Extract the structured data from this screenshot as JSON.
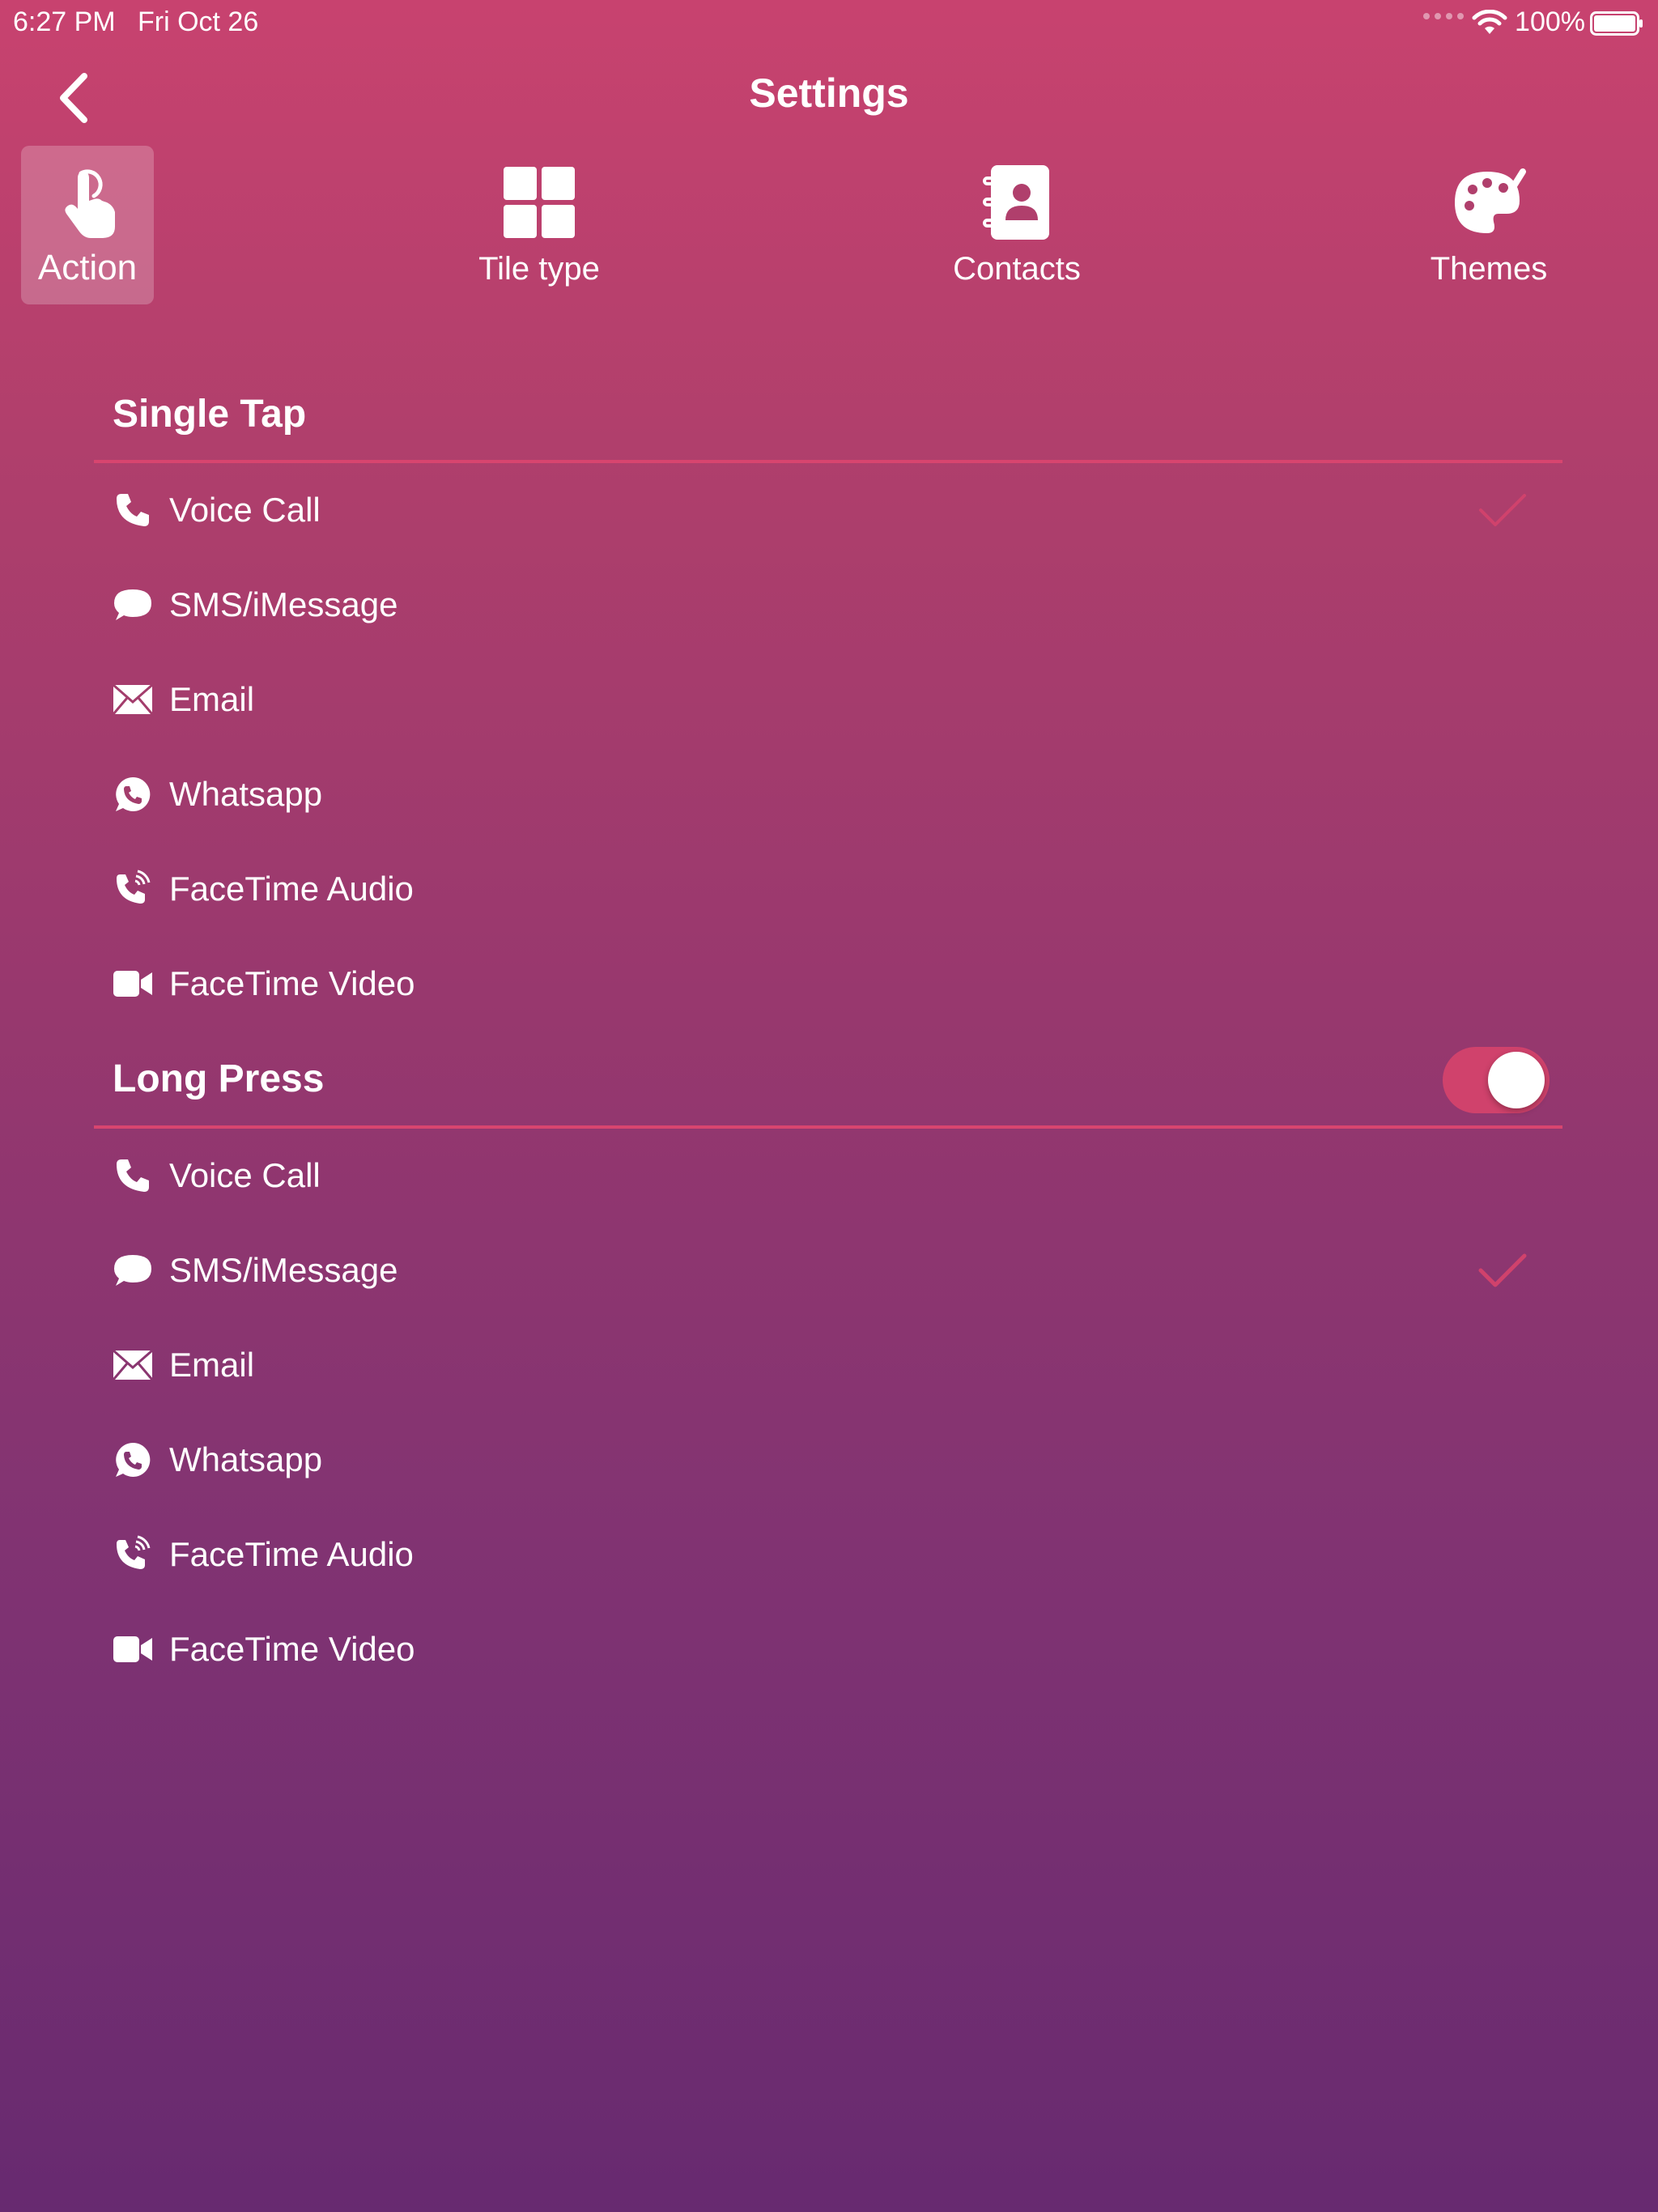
{
  "status_bar": {
    "time": "6:27 PM",
    "date": "Fri Oct 26",
    "battery": "100%"
  },
  "header": {
    "title": "Settings",
    "back_icon": "chevron-left-icon"
  },
  "tabs": [
    {
      "label": "Action",
      "icon": "hand-pointer-icon",
      "selected": true
    },
    {
      "label": "Tile type",
      "icon": "grid-icon",
      "selected": false
    },
    {
      "label": "Contacts",
      "icon": "address-book-icon",
      "selected": false
    },
    {
      "label": "Themes",
      "icon": "palette-icon",
      "selected": false
    }
  ],
  "single_tap": {
    "title": "Single Tap",
    "selected": "Voice Call",
    "items": [
      {
        "label": "Voice Call",
        "icon": "phone-icon"
      },
      {
        "label": "SMS/iMessage",
        "icon": "chat-bubble-icon"
      },
      {
        "label": "Email",
        "icon": "envelope-icon"
      },
      {
        "label": "Whatsapp",
        "icon": "whatsapp-icon"
      },
      {
        "label": "FaceTime Audio",
        "icon": "phone-volume-icon"
      },
      {
        "label": "FaceTime Video",
        "icon": "video-camera-icon"
      }
    ]
  },
  "long_press": {
    "title": "Long Press",
    "enabled": true,
    "selected": "SMS/iMessage",
    "items": [
      {
        "label": "Voice Call",
        "icon": "phone-icon"
      },
      {
        "label": "SMS/iMessage",
        "icon": "chat-bubble-icon"
      },
      {
        "label": "Email",
        "icon": "envelope-icon"
      },
      {
        "label": "Whatsapp",
        "icon": "whatsapp-icon"
      },
      {
        "label": "FaceTime Audio",
        "icon": "phone-volume-icon"
      },
      {
        "label": "FaceTime Video",
        "icon": "video-camera-icon"
      }
    ]
  },
  "colors": {
    "accent": "#d0426c",
    "gradient_top": "#c8426f",
    "gradient_bottom": "#672a70"
  }
}
